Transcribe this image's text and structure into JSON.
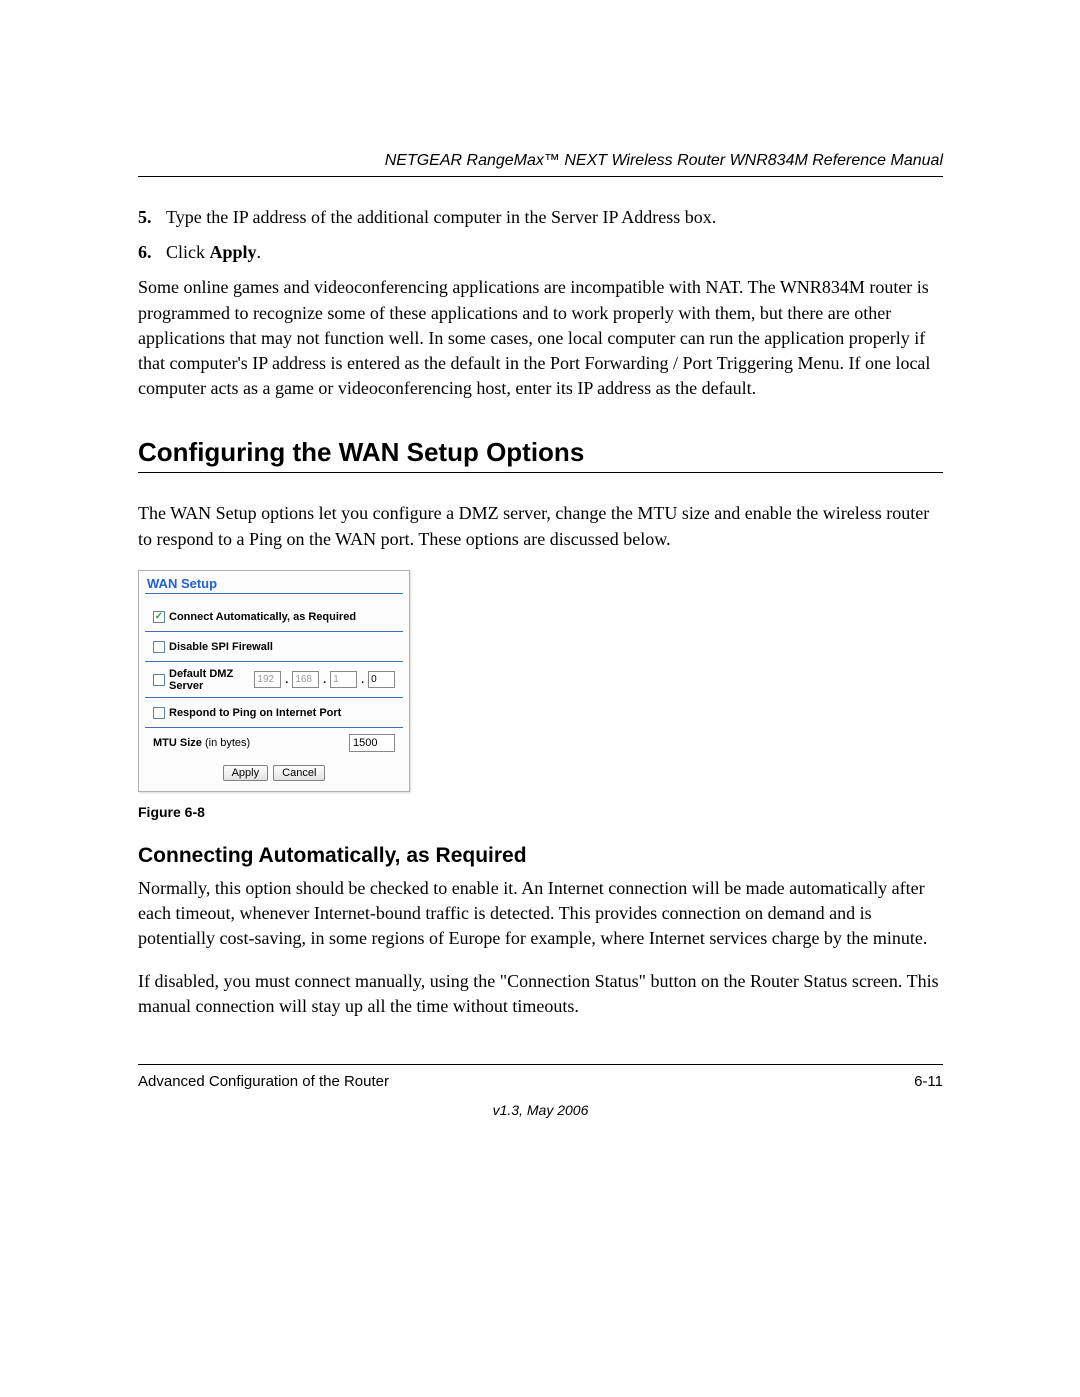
{
  "header": {
    "title": "NETGEAR RangeMax™ NEXT Wireless Router WNR834M Reference Manual"
  },
  "steps": {
    "item5": {
      "num": "5.",
      "text": "Type the IP address of the additional computer in the Server IP Address box."
    },
    "item6": {
      "num": "6.",
      "prefix": "Click ",
      "bold": "Apply",
      "suffix": "."
    }
  },
  "para1": "Some online games and videoconferencing applications are incompatible with NAT. The WNR834M router is programmed to recognize some of these applications and to work properly with them, but there are other applications that may not function well. In some cases, one local computer can run the application properly if that computer's IP address is entered as the default in the Port Forwarding / Port Triggering Menu. If one local computer acts as a game or videoconferencing host, enter its IP address as the default.",
  "h1": "Configuring the WAN Setup Options",
  "para2": "The WAN Setup options let you configure a DMZ server, change the MTU size and enable the wireless router to respond to a Ping on the WAN port. These options are discussed below.",
  "wan": {
    "title": "WAN Setup",
    "connect_auto": "Connect Automatically, as Required",
    "disable_spi": "Disable SPI Firewall",
    "dmz_label": "Default DMZ Server",
    "dmz_ip": {
      "a": "192",
      "b": "168",
      "c": "1",
      "d": "0"
    },
    "respond_ping": "Respond to Ping on Internet Port",
    "mtu_label": "MTU Size",
    "mtu_hint": "(in bytes)",
    "mtu_value": "1500",
    "apply": "Apply",
    "cancel": "Cancel"
  },
  "fig_caption": "Figure 6-8",
  "h2": "Connecting Automatically, as Required",
  "para3": "Normally, this option should be checked to enable it. An Internet connection will be made automatically after each timeout, whenever Internet-bound traffic is detected. This provides connection on demand and is potentially cost-saving, in some regions of Europe for example, where Internet services charge by the minute.",
  "para4": "If disabled, you must connect manually, using the \"Connection Status\" button on the Router Status screen. This manual connection will stay up all the time without timeouts.",
  "footer": {
    "left": "Advanced Configuration of the Router",
    "right": "6-11",
    "version": "v1.3, May 2006"
  }
}
